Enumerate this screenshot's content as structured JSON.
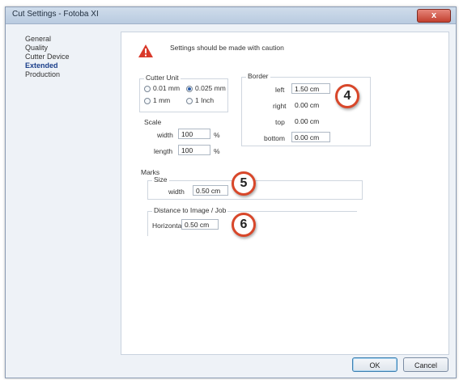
{
  "window": {
    "title": "Cut Settings - Fotoba XI",
    "close_label": "x"
  },
  "nav": {
    "items": [
      {
        "label": "General"
      },
      {
        "label": "Quality"
      },
      {
        "label": "Cutter Device"
      },
      {
        "label": "Extended",
        "active": true
      },
      {
        "label": "Production"
      }
    ]
  },
  "warning": {
    "text": "Settings should be made with caution",
    "icon": "warning-icon"
  },
  "cutter_unit": {
    "label": "Cutter Unit",
    "options": [
      {
        "label": "0.01 mm",
        "checked": false
      },
      {
        "label": "0.025 mm",
        "checked": true
      },
      {
        "label": "1 mm",
        "checked": false
      },
      {
        "label": "1 Inch",
        "checked": false
      }
    ]
  },
  "scale": {
    "label": "Scale",
    "width_label": "width",
    "width_value": "100",
    "width_unit": "%",
    "length_label": "length",
    "length_value": "100",
    "length_unit": "%"
  },
  "border": {
    "label": "Border",
    "left_label": "left",
    "left_value": "1.50 cm",
    "right_label": "right",
    "right_value": "0.00 cm",
    "top_label": "top",
    "top_value": "0.00 cm",
    "bottom_label": "bottom",
    "bottom_value": "0.00 cm"
  },
  "marks": {
    "label": "Marks",
    "size_label": "Size",
    "width_label": "width",
    "width_value": "0.50 cm"
  },
  "distance": {
    "label": "Distance to Image / Job",
    "horizontal_label": "Horizontal",
    "horizontal_value": "0.50 cm"
  },
  "callouts": [
    "4",
    "5",
    "6"
  ],
  "buttons": {
    "ok": "OK",
    "cancel": "Cancel"
  },
  "colors": {
    "accent": "#d8472a",
    "active_nav": "#1a3e8a"
  }
}
